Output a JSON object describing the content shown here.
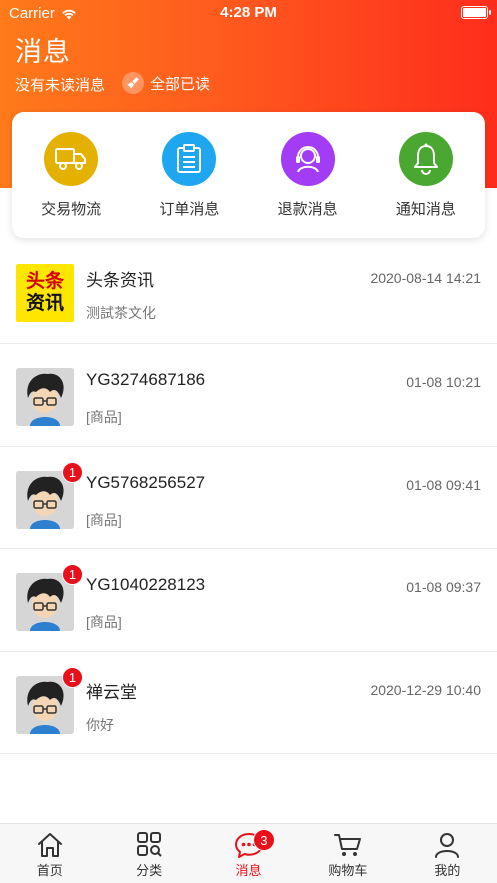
{
  "status_bar": {
    "carrier": "Carrier",
    "time": "4:28 PM"
  },
  "header": {
    "title": "消息",
    "unread_text": "没有未读消息",
    "mark_all_read": "全部已读"
  },
  "categories": [
    {
      "label": "交易物流",
      "icon": "truck-icon",
      "color": "#e5b100"
    },
    {
      "label": "订单消息",
      "icon": "clipboard-icon",
      "color": "#1ea6f0"
    },
    {
      "label": "退款消息",
      "icon": "support-agent-icon",
      "color": "#a23cf5"
    },
    {
      "label": "通知消息",
      "icon": "bell-icon",
      "color": "#4aa832"
    }
  ],
  "messages": [
    {
      "title": "头条资讯",
      "subtitle": "测試茶文化",
      "time": "2020-08-14 14:21",
      "avatar": "news-logo",
      "logo_top": "头条",
      "logo_bottom": "资讯",
      "badge": ""
    },
    {
      "title": "YG3274687186",
      "subtitle": "[商品]",
      "time": "01-08 10:21",
      "avatar": "cartoon-avatar",
      "badge": ""
    },
    {
      "title": "YG5768256527",
      "subtitle": "[商品]",
      "time": "01-08 09:41",
      "avatar": "cartoon-avatar",
      "badge": "1"
    },
    {
      "title": "YG1040228123",
      "subtitle": "[商品]",
      "time": "01-08 09:37",
      "avatar": "cartoon-avatar",
      "badge": "1"
    },
    {
      "title": "禅云堂",
      "subtitle": "你好",
      "time": "2020-12-29 10:40",
      "avatar": "cartoon-avatar",
      "badge": "1"
    }
  ],
  "tabbar": {
    "items": [
      {
        "label": "首页",
        "icon": "home-icon"
      },
      {
        "label": "分类",
        "icon": "category-icon"
      },
      {
        "label": "消息",
        "icon": "chat-icon",
        "active": true,
        "badge": "3"
      },
      {
        "label": "购物车",
        "icon": "cart-icon"
      },
      {
        "label": "我的",
        "icon": "user-icon"
      }
    ]
  },
  "colors": {
    "accent": "#e8101a",
    "header_start": "#ff7a1a",
    "header_end": "#ff2d1c"
  }
}
